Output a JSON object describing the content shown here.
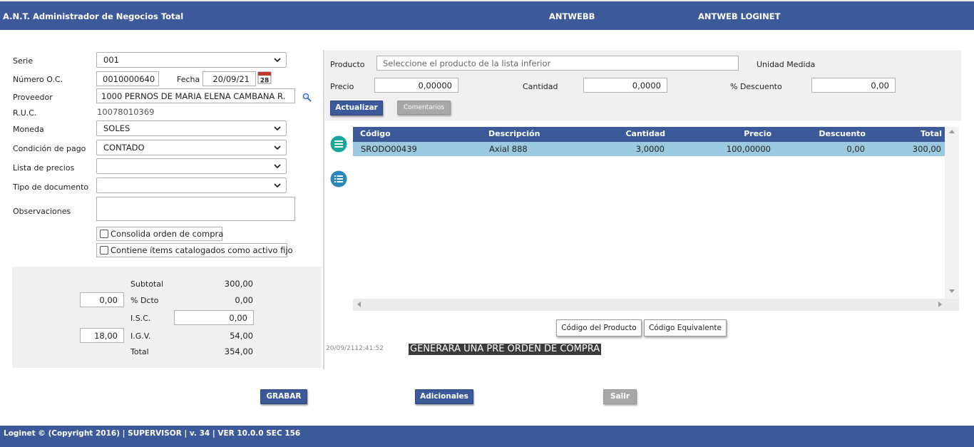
{
  "header": {
    "app_title": "A.N.T. Administrador de Negocios Total",
    "company": "ANTWEBB",
    "module": "ANTWEB LOGINET"
  },
  "form": {
    "serie_label": "Serie",
    "serie_value": "001",
    "numero_label": "Número O.C.",
    "numero_value": "0010000640",
    "fecha_label": "Fecha",
    "fecha_value": "20/09/21",
    "calendar_day": "28",
    "proveedor_label": "Proveedor",
    "proveedor_value": "1000 PERNOS DE MARIA ELENA CAMBANA R.",
    "ruc_label": "R.U.C.",
    "ruc_value": "10078010369",
    "moneda_label": "Moneda",
    "moneda_value": "SOLES",
    "condicion_label": "Condición de pago",
    "condicion_value": "CONTADO",
    "lista_label": "Lista de precios",
    "lista_value": "",
    "tipo_label": "Tipo de documento",
    "tipo_value": "",
    "obs_label": "Observaciones",
    "obs_value": "",
    "consolida_label": "Consolida orden de compra",
    "activo_label": "Contiene ítems catalogados como activo fijo"
  },
  "totals": {
    "subtotal_label": "Subtotal",
    "subtotal_value": "300,00",
    "dcto_input": "0,00",
    "dcto_label": "% Dcto",
    "dcto_value": "0,00",
    "isc_label": "I.S.C.",
    "isc_input": "0,00",
    "igv_input": "18,00",
    "igv_label": "I.G.V.",
    "igv_value": "54,00",
    "total_label": "Total",
    "total_value": "354,00"
  },
  "product": {
    "producto_label": "Producto",
    "producto_placeholder": "Seleccione el producto de la lista inferior",
    "unidad_label": "Unidad Medida",
    "precio_label": "Precio",
    "precio_value": "0,00000",
    "cantidad_label": "Cantidad",
    "cantidad_value": "0,0000",
    "descuento_label": "% Descuento",
    "descuento_value": "0,00",
    "actualizar_label": "Actualizar",
    "comentarios_label": "Comentarios"
  },
  "grid": {
    "columns": [
      "Código",
      "Descripción",
      "Cantidad",
      "Precio",
      "Descuento",
      "Total"
    ],
    "rows": [
      [
        "SRODO00439",
        "Axial 888",
        "3,0000",
        "100,00000",
        "0,00",
        "300,00"
      ]
    ]
  },
  "actions": {
    "codigo_producto": "Código del Producto",
    "codigo_equivalente": "Código Equivalente",
    "timestamp": "20/09/2112:41:52",
    "message": "GENERARÁ UNA PRE ORDEN DE COMPRA",
    "grabar": "GRABAR",
    "adicionales": "Adicionales",
    "salir": "Salir"
  },
  "footer": {
    "text": "Loginet © (Copyright 2016) | SUPERVISOR | v. 34 | VER 10.0.0 SEC 156"
  },
  "colors": {
    "brand": "#3c5a9a",
    "selected_row": "#9ac9e0",
    "icon_teal": "#1aa59a",
    "icon_blue": "#2a88bd"
  },
  "icons": [
    "chevron-down-icon",
    "calendar-icon",
    "search-icon",
    "menu-circle-icon",
    "list-circle-icon",
    "scroll-arrow-icon"
  ]
}
